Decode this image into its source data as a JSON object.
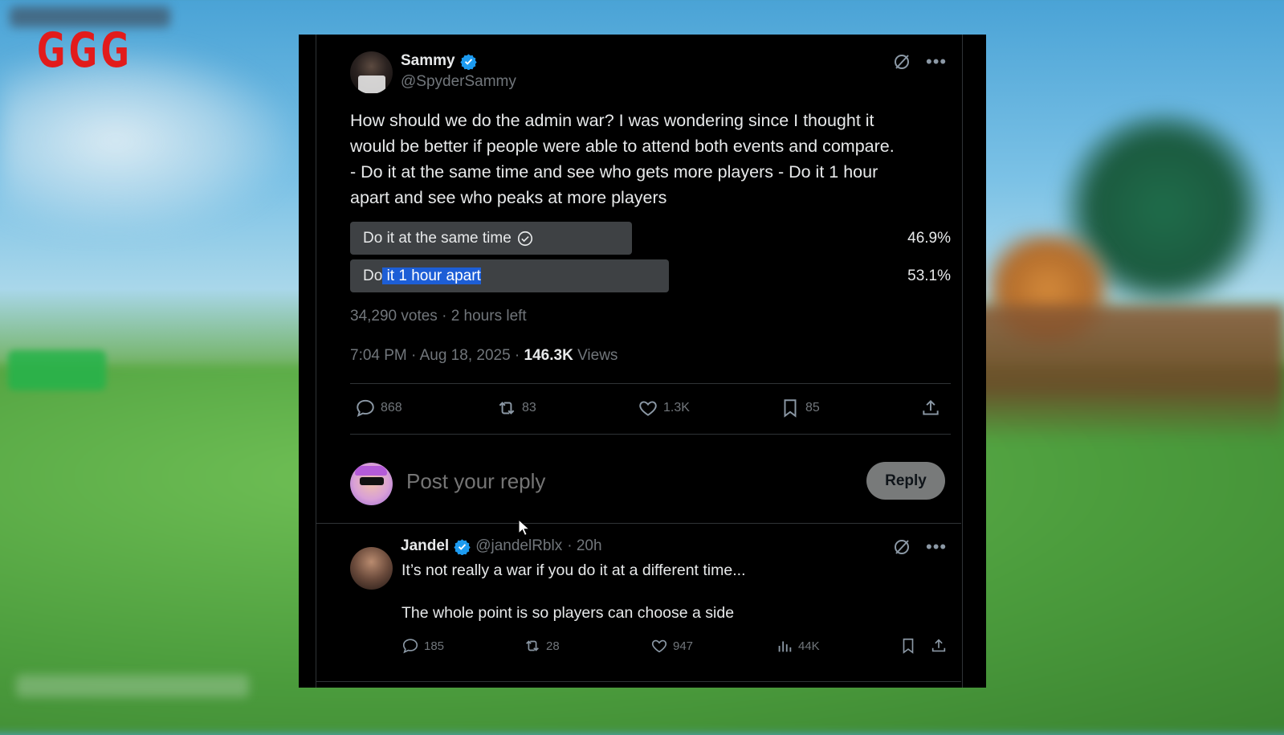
{
  "brand": {
    "logo_text": "GGG",
    "logo_color": "#e21b1b"
  },
  "tweet": {
    "author_name": "Sammy",
    "author_handle": "@SpyderSammy",
    "text_lines": [
      "How should we do the admin war? I was wondering since I thought it",
      "would be better if people were able to attend both events and compare.",
      "- Do it at the same time and see who gets more players - Do it 1 hour",
      "apart and see who peaks at more players"
    ],
    "poll": {
      "options": [
        {
          "label": "Do it at the same time",
          "percent": "46.9%",
          "fraction": 0.469,
          "voted": true
        },
        {
          "label": "Do it 1 hour apart",
          "label_prefix": "Do",
          "label_highlight": " it 1 hour apart",
          "percent": "53.1%",
          "fraction": 0.531,
          "voted": false
        }
      ],
      "votes": "34,290 votes",
      "time_left": "2 hours left",
      "separator": "·"
    },
    "timestamp": "7:04 PM · Aug 18, 2025 ·",
    "views_count": "146.3K",
    "views_label": "Views",
    "stats": {
      "replies": "868",
      "reposts": "83",
      "likes": "1.3K",
      "bookmarks": "85"
    }
  },
  "composer": {
    "placeholder": "Post your reply",
    "button_label": "Reply"
  },
  "reply": {
    "author_name": "Jandel",
    "author_handle": "@jandelRblx",
    "time": "· 20h",
    "line1": "It’s not really a war if you do it at a different time...",
    "line2": "The whole point is so players can choose a side",
    "stats": {
      "replies": "185",
      "reposts": "28",
      "likes": "947",
      "views": "44K"
    }
  },
  "colors": {
    "accent_blue": "#1d9bf0",
    "panel_bg": "#000000",
    "muted": "#71767b",
    "poll_fill": "#3e4144"
  },
  "icons": [
    "verified-badge-icon",
    "grok-icon",
    "more-icon",
    "check-circle-icon",
    "reply-icon",
    "repost-icon",
    "like-icon",
    "bookmark-icon",
    "share-icon",
    "views-icon",
    "cursor-icon"
  ]
}
